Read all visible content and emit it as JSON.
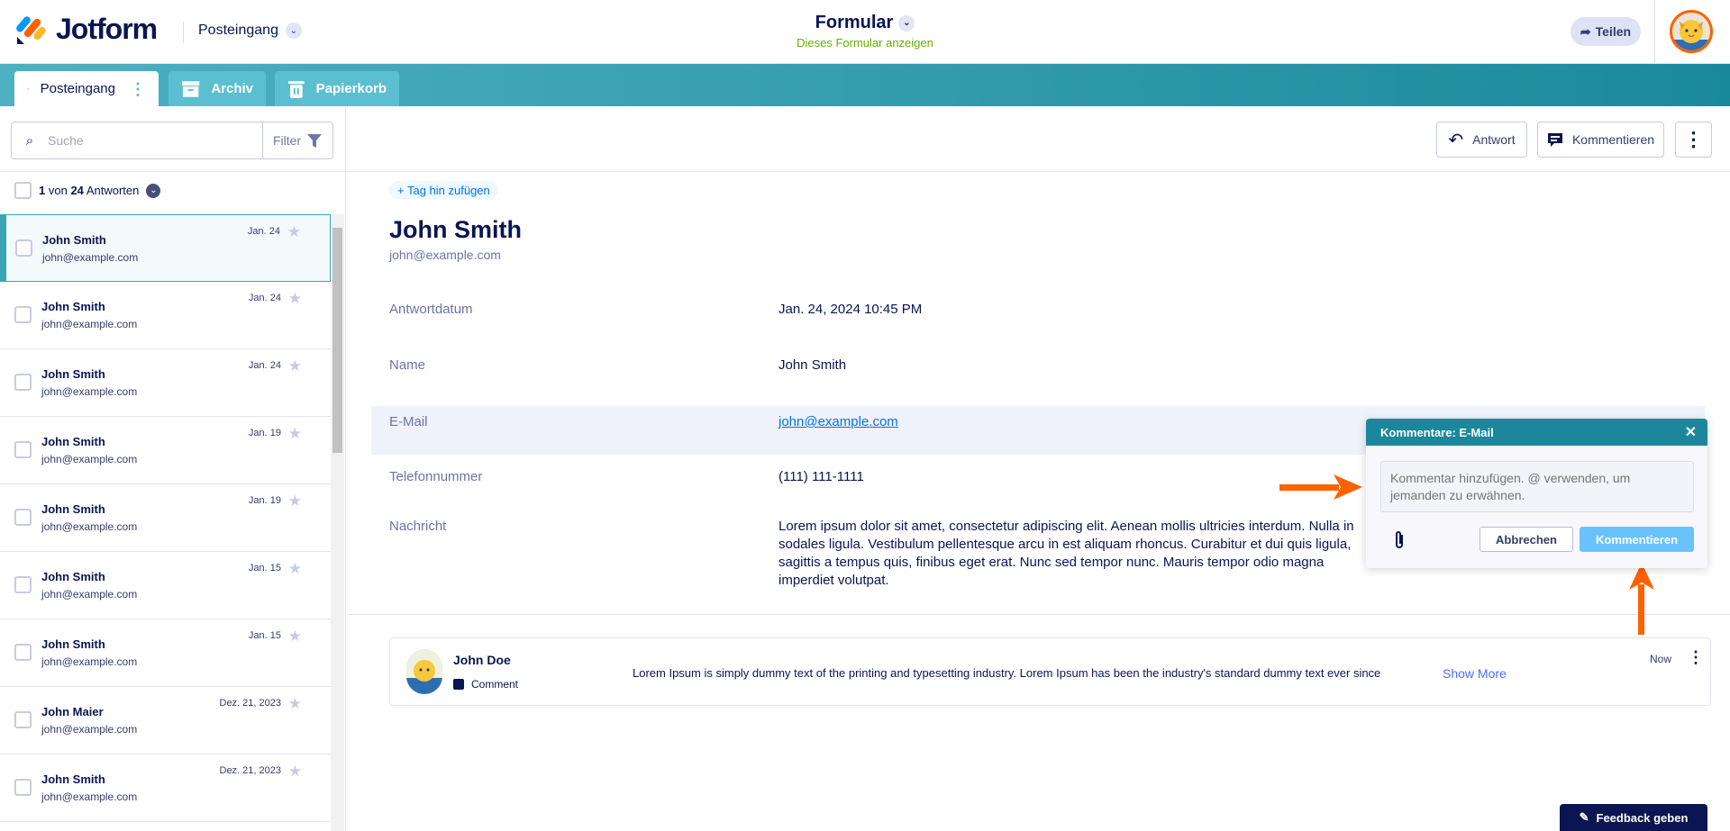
{
  "header": {
    "logo": "Jotform",
    "inbox_selector": "Posteingang",
    "form_title": "Formular",
    "form_link": "Dieses Formular anzeigen",
    "share_label": "Teilen"
  },
  "tabs": [
    {
      "label": "Posteingang"
    },
    {
      "label": "Archiv"
    },
    {
      "label": "Papierkorb"
    }
  ],
  "sidebar": {
    "search_placeholder": "Suche",
    "filter_label": "Filter",
    "count_current": "1",
    "count_von": "von",
    "count_total": "24",
    "count_suffix": "Antworten",
    "items": [
      {
        "name": "John Smith",
        "email": "john@example.com",
        "date": "Jan. 24"
      },
      {
        "name": "John Smith",
        "email": "john@example.com",
        "date": "Jan. 24"
      },
      {
        "name": "John Smith",
        "email": "john@example.com",
        "date": "Jan. 24"
      },
      {
        "name": "John Smith",
        "email": "john@example.com",
        "date": "Jan. 19"
      },
      {
        "name": "John Smith",
        "email": "john@example.com",
        "date": "Jan. 19"
      },
      {
        "name": "John Smith",
        "email": "john@example.com",
        "date": "Jan. 15"
      },
      {
        "name": "John Smith",
        "email": "john@example.com",
        "date": "Jan. 15"
      },
      {
        "name": "John Maier",
        "email": "john@example.com",
        "date": "Dez. 21, 2023"
      },
      {
        "name": "John Smith",
        "email": "john@example.com",
        "date": "Dez. 21, 2023"
      }
    ]
  },
  "toolbar": {
    "reply_label": "Antwort",
    "comment_label": "Kommentieren"
  },
  "submission": {
    "tag_label": "+ Tag hin zufügen",
    "name": "John Smith",
    "email": "john@example.com",
    "fields": [
      {
        "label": "Antwortdatum",
        "value": "Jan. 24, 2024 10:45 PM"
      },
      {
        "label": "Name",
        "value": "John Smith"
      },
      {
        "label": "E-Mail",
        "value": "john@example.com"
      },
      {
        "label": "Telefonnummer",
        "value": "(111) 111-1111"
      },
      {
        "label": "Nachricht",
        "value": "Lorem ipsum dolor sit amet, consectetur adipiscing elit. Aenean mollis ultricies interdum. Nulla in sodales ligula. Vestibulum pellentesque arcu in est aliquam rhoncus. Curabitur et dui quis ligula, sagittis a tempus quis, finibus eget erat. Nunc sed tempor nunc. Mauris tempor odio magna imperdiet volutpat."
      }
    ]
  },
  "comment": {
    "author": "John Doe",
    "type": "Comment",
    "text": "Lorem Ipsum is simply dummy text of the printing and typesetting industry. Lorem Ipsum has been the industry's standard dummy text ever since",
    "show_more": "Show More",
    "time": "Now"
  },
  "popup": {
    "title": "Kommentare: E-Mail",
    "placeholder": "Kommentar hinzufügen. @ verwenden, um jemanden zu erwähnen.",
    "cancel_label": "Abbrechen",
    "submit_label": "Kommentieren"
  },
  "feedback_label": "Feedback geben",
  "colors": {
    "teal": "#1c879b",
    "accent_orange": "#ff6100",
    "navy": "#0a1551",
    "link": "#0075e3"
  }
}
